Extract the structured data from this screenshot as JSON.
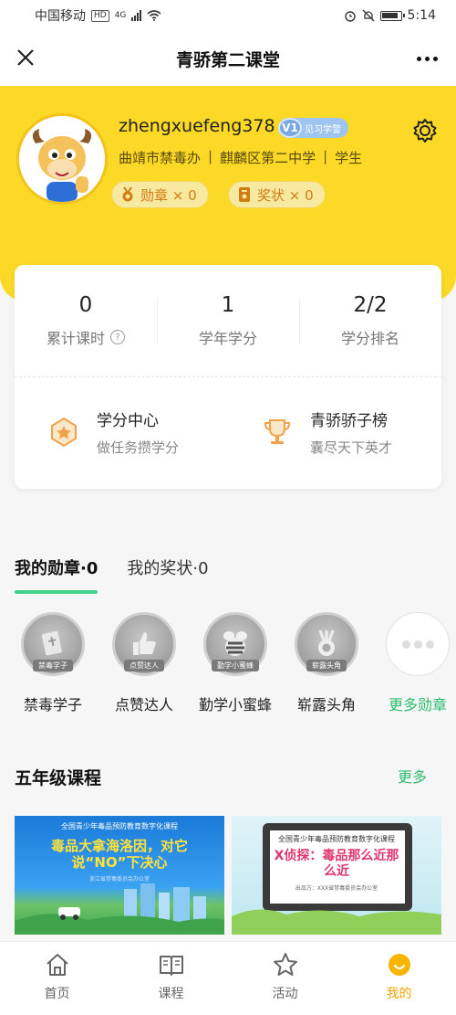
{
  "status_bar": {
    "carrier": "中国移动",
    "hd": "HD",
    "network": "4G",
    "time": "5:14"
  },
  "header": {
    "title": "青骄第二课堂"
  },
  "profile": {
    "username": "zhengxuefeng378",
    "level_code": "V1",
    "level_title": "见习学警",
    "org": [
      "曲靖市禁毒办",
      "麒麟区第二中学",
      "学生"
    ],
    "medals_label": "勋章 × 0",
    "awards_label": "奖状 × 0"
  },
  "stats": [
    {
      "value": "0",
      "label": "累计课时"
    },
    {
      "value": "1",
      "label": "学年学分"
    },
    {
      "value": "2/2",
      "label": "学分排名"
    }
  ],
  "features": [
    {
      "title": "学分中心",
      "subtitle": "做任务攒学分"
    },
    {
      "title": "青骄骄子榜",
      "subtitle": "囊尽天下英才"
    }
  ],
  "tabs": [
    {
      "label": "我的勋章·0",
      "active": true
    },
    {
      "label": "我的奖状·0",
      "active": false
    }
  ],
  "badges": [
    {
      "name": "禁毒学子",
      "ribbon": "禁毒学子",
      "icon": "book-icon"
    },
    {
      "name": "点赞达人",
      "ribbon": "点赞达人",
      "icon": "thumbs-up-icon"
    },
    {
      "name": "勤学小蜜蜂",
      "ribbon": "勤学小蜜蜂",
      "icon": "bee-icon"
    },
    {
      "name": "崭露头角",
      "ribbon": "崭露头角",
      "icon": "medal-icon"
    },
    {
      "name": "更多勋章",
      "icon": "more-icon"
    }
  ],
  "courses_section": {
    "title": "五年级课程",
    "more": "更多"
  },
  "courses": [
    {
      "header": "全国青少年毒品预防教育数字化课程",
      "title": "毒品大拿海洛因，对它说“NO”下决心",
      "sub": "浙江省禁毒委员会办公室"
    },
    {
      "header": "全国青少年毒品预防教育数字化课程",
      "title": "X侦探：毒品那么近那么近",
      "sub": "出品方：XXX省禁毒委员会办公室"
    }
  ],
  "nav": [
    {
      "label": "首页",
      "icon": "home-icon"
    },
    {
      "label": "课程",
      "icon": "book-icon"
    },
    {
      "label": "活动",
      "icon": "star-icon"
    },
    {
      "label": "我的",
      "icon": "profile-icon",
      "active": true
    }
  ],
  "colors": {
    "accent_yellow": "#fbd926",
    "green": "#2ebd6e",
    "orange": "#f1a500"
  }
}
